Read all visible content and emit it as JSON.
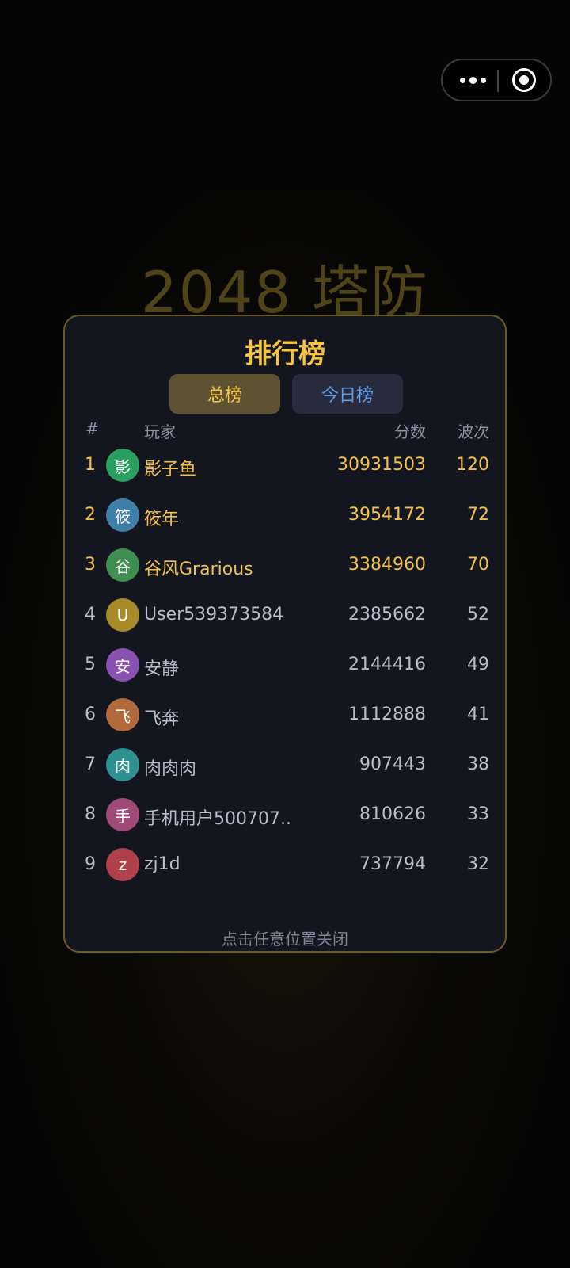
{
  "background": {
    "title": "2048 塔防"
  },
  "capsule": {
    "more_icon": "more-dots-icon",
    "close_icon": "target-close-icon"
  },
  "leaderboard": {
    "title": "排行榜",
    "tabs": [
      {
        "label": "总榜",
        "active": true
      },
      {
        "label": "今日榜",
        "active": false
      }
    ],
    "columns": {
      "rank": "#",
      "player": "玩家",
      "score": "分数",
      "wave": "波次"
    },
    "rows": [
      {
        "rank": "1",
        "avatar": "影",
        "avatar_color": "#2aa060",
        "name": "影子鱼",
        "score": "30931503",
        "wave": "120",
        "highlight": true
      },
      {
        "rank": "2",
        "avatar": "筱",
        "avatar_color": "#3f7fa8",
        "name": "筱年",
        "score": "3954172",
        "wave": "72",
        "highlight": true
      },
      {
        "rank": "3",
        "avatar": "谷",
        "avatar_color": "#3f9050",
        "name": "谷风Grarious",
        "score": "3384960",
        "wave": "70",
        "highlight": true
      },
      {
        "rank": "4",
        "avatar": "U",
        "avatar_color": "#a88a28",
        "name": "User539373584",
        "score": "2385662",
        "wave": "52",
        "highlight": false
      },
      {
        "rank": "5",
        "avatar": "安",
        "avatar_color": "#8a52b0",
        "name": "安静",
        "score": "2144416",
        "wave": "49",
        "highlight": false
      },
      {
        "rank": "6",
        "avatar": "飞",
        "avatar_color": "#b06a3c",
        "name": "飞奔",
        "score": "1112888",
        "wave": "41",
        "highlight": false
      },
      {
        "rank": "7",
        "avatar": "肉",
        "avatar_color": "#2e9090",
        "name": "肉肉肉",
        "score": "907443",
        "wave": "38",
        "highlight": false
      },
      {
        "rank": "8",
        "avatar": "手",
        "avatar_color": "#a04a7a",
        "name": "手机用户500707..",
        "score": "810626",
        "wave": "33",
        "highlight": false
      },
      {
        "rank": "9",
        "avatar": "z",
        "avatar_color": "#b0404a",
        "name": "zj1d",
        "score": "737794",
        "wave": "32",
        "highlight": false
      }
    ],
    "close_hint": "点击任意位置关闭"
  }
}
